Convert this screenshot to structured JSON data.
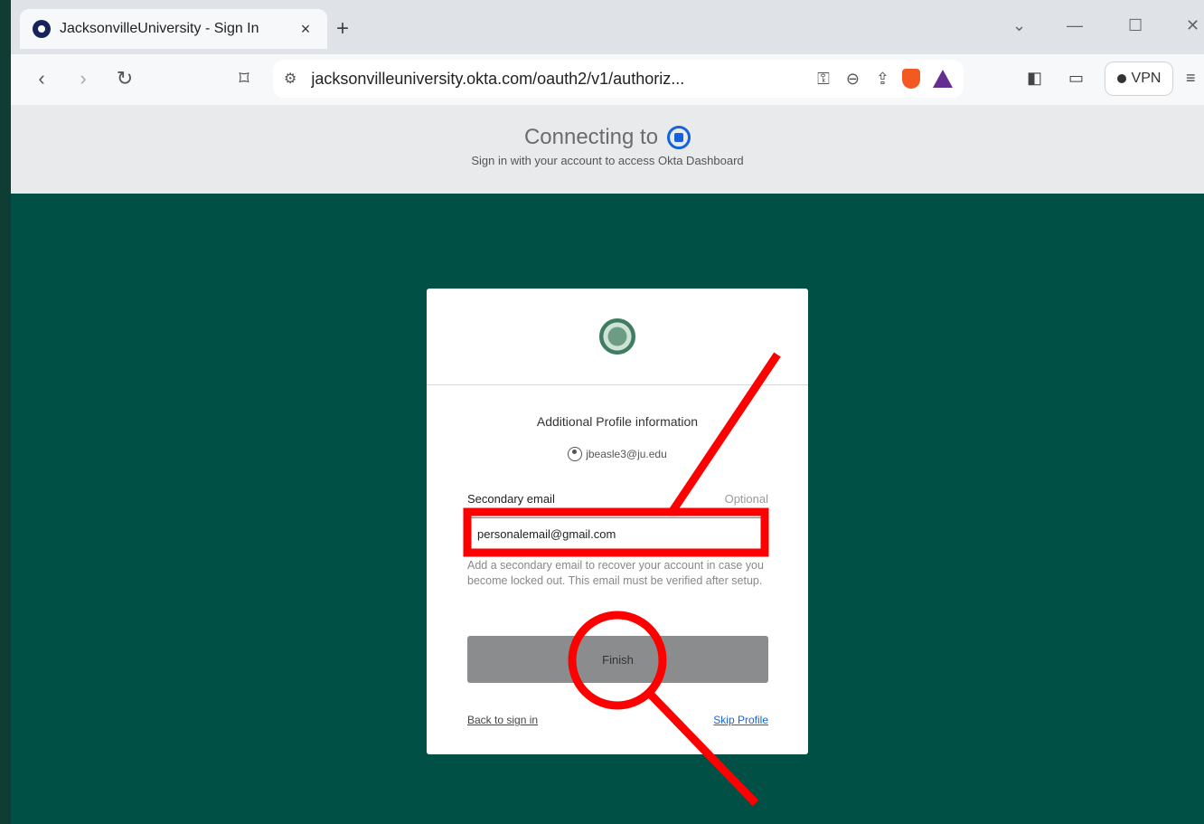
{
  "browser": {
    "tab_title": "JacksonvilleUniversity - Sign In",
    "tab_close": "×",
    "new_tab": "+",
    "url": "jacksonvilleuniversity.okta.com/oauth2/v1/authoriz...",
    "vpn_label": "VPN"
  },
  "okta_header": {
    "connecting": "Connecting to",
    "subtitle": "Sign in with your account to access Okta Dashboard"
  },
  "card": {
    "heading": "Additional Profile information",
    "identifier": "jbeasle3@ju.edu",
    "field_label": "Secondary email",
    "field_optional": "Optional",
    "field_value": "personalemail@gmail.com",
    "help_text": "Add a secondary email to recover your account in case you become locked out. This email must be verified after setup.",
    "finish_label": "Finish",
    "back_link": "Back to sign in",
    "skip_link": "Skip Profile"
  },
  "colors": {
    "page_bg": "#005046",
    "annotation": "#ff0000",
    "link": "#1662dd"
  }
}
